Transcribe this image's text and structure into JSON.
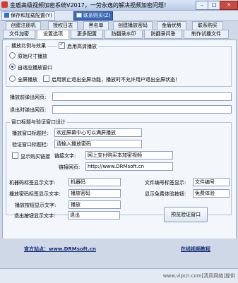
{
  "window": {
    "title": "金盾高级视频加密系统V2017，一劳永逸的解决视频加密问题！",
    "min": "–",
    "max": "□",
    "close": "✕"
  },
  "toolbar": {
    "save_label": "保存和加载配置(Y)",
    "contact_label": "联系购买(Z)"
  },
  "tabs_row1": [
    "创建注册机",
    "授权日志",
    "黑名单",
    "创建播放密码",
    "金盾优势",
    "联系购买"
  ],
  "tabs_row2": [
    "文件加密",
    "设置选项",
    "更多配置",
    "防翻录水印",
    "防翻录问答",
    "制作试播文件"
  ],
  "player": {
    "group_label": "播放比例与效果",
    "hq_checkbox": "启用高清播放",
    "radio_original": "原始尺寸播放",
    "radio_adaptive": "自适应播放窗口",
    "radio_fullscreen": "全屏播放",
    "disable_fullscreen": "启用禁止退出全屏功能，播放时不允许用户退出全屏状态！"
  },
  "urls": {
    "before_label": "播放前弹出网页:",
    "before_value": "",
    "after_label": "退出时弹出网页:",
    "after_value": ""
  },
  "window_design": {
    "group_label": "窗口标题与验证窗口设计",
    "player_title_label": "播放窗口标题栏:",
    "player_title_value": "欢迎屏幕中心可以满屏播放",
    "verify_title_label": "验证窗口标题栏:",
    "verify_title_value": "请输入播放密码",
    "show_buy_link": "显示购买链接",
    "link_text_label": "链接文字:",
    "link_text_value": "网上支付购买本加密视频",
    "link_url_label": "链接网页:",
    "link_url_value": "http://www.DRMsoft.cn",
    "machine_label": "机器码标签显示文字:",
    "machine_value": "机器码",
    "password_label": "播放密码标签显示文字:",
    "password_value": "播放密码",
    "play_btn_label": "播放按钮显示文字:",
    "play_btn_value": "播放",
    "exit_btn_label": "退出按钮显示文字:",
    "exit_btn_value": "退出",
    "filenum_label": "文件编号标签显示:",
    "filenum_value": "文件编号",
    "free_label": "显示免费体验按钮:",
    "free_value": "免费体验",
    "preview_button": "预览验证窗口"
  },
  "footer": {
    "site_label": "官方站点：www.DRMsoft.cn",
    "tutorial_label": "在线视频教程"
  },
  "status": {
    "watermark": "www.vipcn.com[清风网络]提供"
  }
}
